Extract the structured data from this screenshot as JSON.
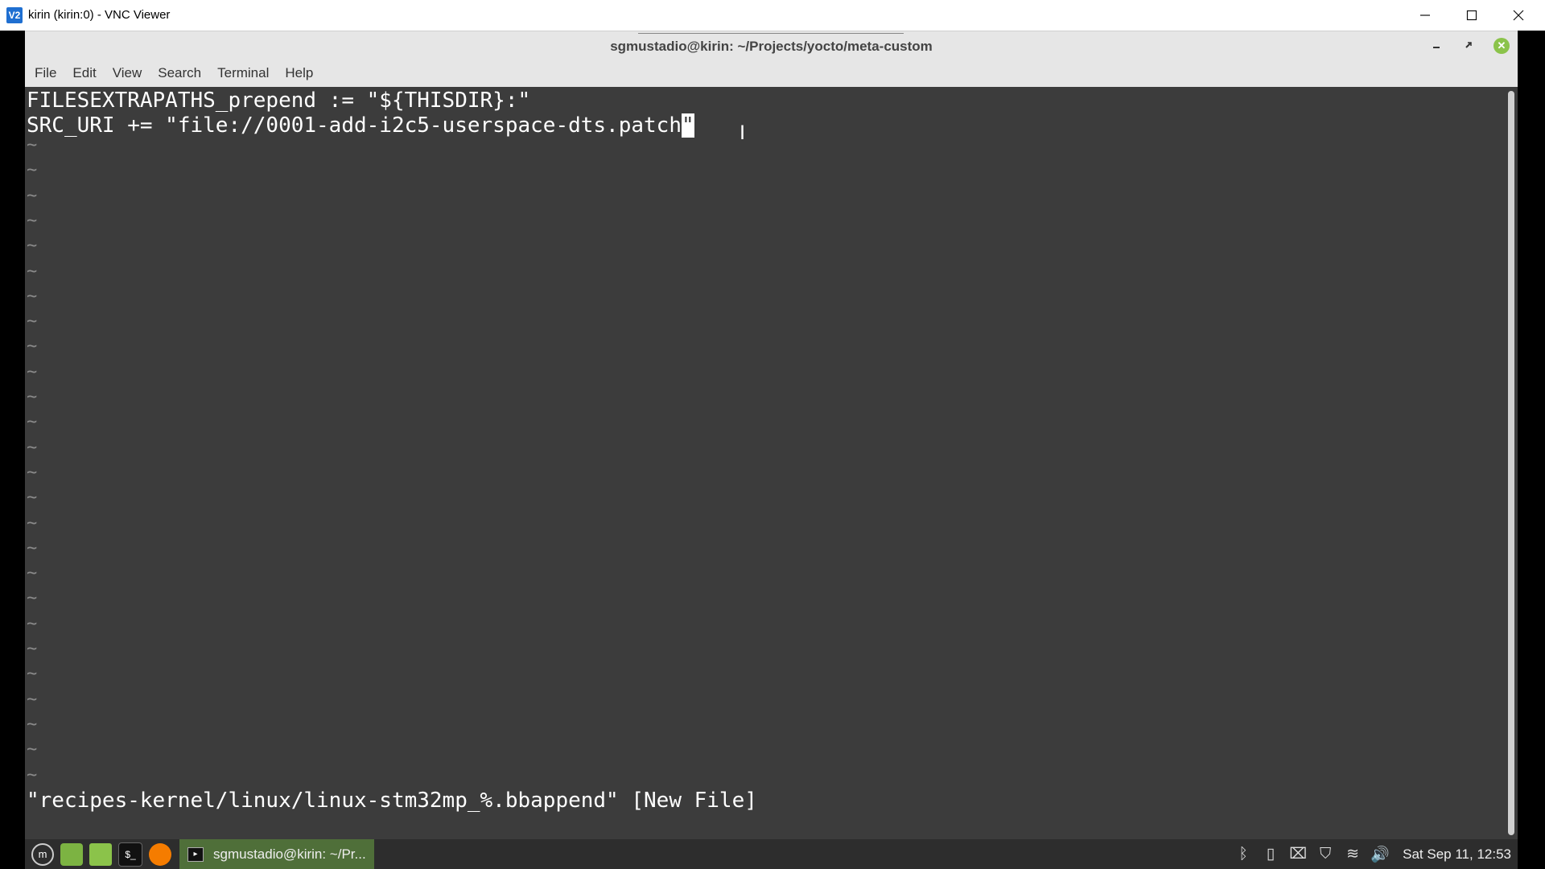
{
  "vnc": {
    "logo": "V2",
    "title": "kirin (kirin:0) - VNC Viewer",
    "minimize_icon": "minimize-icon",
    "maximize_icon": "maximize-icon",
    "close_icon": "close-icon"
  },
  "terminal": {
    "title": "sgmustadio@kirin: ~/Projects/yocto/meta-custom",
    "menu": [
      "File",
      "Edit",
      "View",
      "Search",
      "Terminal",
      "Help"
    ],
    "lines": [
      "FILESEXTRAPATHS_prepend := \"${THISDIR}:\"",
      "SRC_URI += \"file://0001-add-i2c5-userspace-dts.patch"
    ],
    "cursor_char": "\"",
    "tilde": "~",
    "status_line": "\"recipes-kernel/linux/linux-stm32mp_%.bbappend\" [New File]"
  },
  "taskbar": {
    "launchers": [
      "menu-icon",
      "desktop-icon",
      "files-icon",
      "terminal-icon",
      "firefox-icon"
    ],
    "task_label": "sgmustadio@kirin: ~/Pr...",
    "tray": [
      "bluetooth-icon",
      "clipboard-icon",
      "update-icon",
      "shield-icon",
      "wifi-icon",
      "volume-icon"
    ],
    "clock": "Sat Sep 11, 12:53"
  }
}
